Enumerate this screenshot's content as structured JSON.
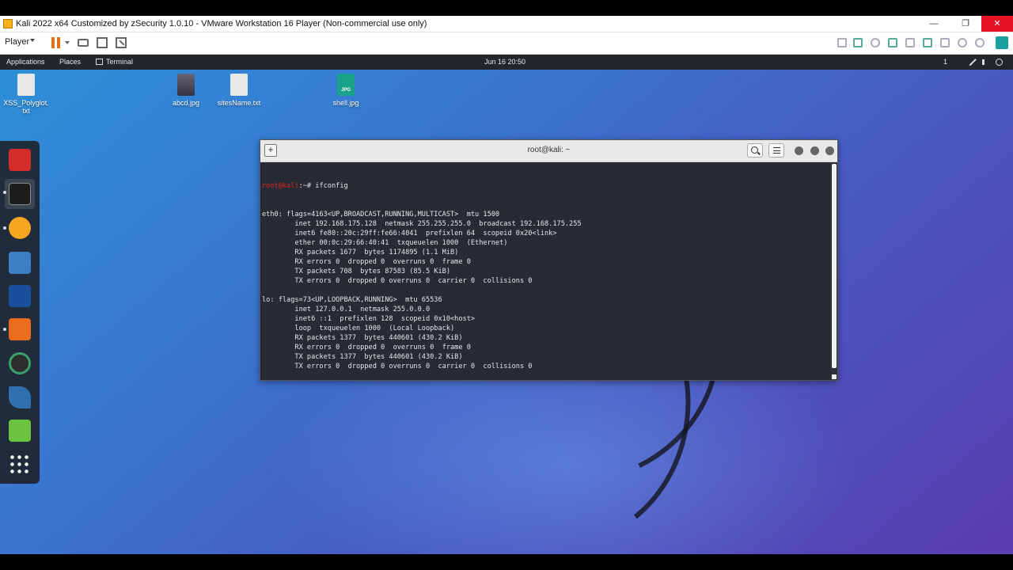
{
  "vm_window": {
    "title": "Kali 2022 x64 Customized by zSecurity 1.0.10 - VMware Workstation 16 Player (Non-commercial use only)",
    "minimize": "—",
    "maximize": "❐",
    "close": "✕"
  },
  "vm_toolbar": {
    "player_menu": "Player"
  },
  "kali_panel": {
    "applications": "Applications",
    "places": "Places",
    "terminal": "Terminal",
    "clock": "Jun 16  20:50",
    "workspace": "1"
  },
  "desktop_icons": [
    {
      "label": "XSS_Polyglot.\ntxt",
      "icon": "text-file-icon"
    },
    {
      "label": "abcd.jpg",
      "icon": "image-file-icon"
    },
    {
      "label": "sitesName.txt",
      "icon": "text-file-icon"
    },
    {
      "label": "shell.jpg",
      "icon": "jpg-file-icon",
      "badge": "JPG"
    }
  ],
  "dock": {
    "items": [
      "terminal-red-icon",
      "terminal-icon",
      "firefox-icon",
      "files-icon",
      "metasploit-icon",
      "burpsuite-icon",
      "maltego-icon",
      "kali-dragon-icon",
      "text-editor-icon",
      "app-grid-icon"
    ]
  },
  "terminal": {
    "title": "root@kali: ~",
    "newtab": "+",
    "prompt_user": "root@kali",
    "prompt_sep": ":~# ",
    "command": "ifconfig",
    "output": [
      "eth0: flags=4163<UP,BROADCAST,RUNNING,MULTICAST>  mtu 1500",
      "        inet 192.168.175.128  netmask 255.255.255.0  broadcast 192.168.175.255",
      "        inet6 fe80::20c:29ff:fe66:4041  prefixlen 64  scopeid 0x20<link>",
      "        ether 00:0c:29:66:40:41  txqueuelen 1000  (Ethernet)",
      "        RX packets 1677  bytes 1174895 (1.1 MiB)",
      "        RX errors 0  dropped 0  overruns 0  frame 0",
      "        TX packets 708  bytes 87583 (85.5 KiB)",
      "        TX errors 0  dropped 0 overruns 0  carrier 0  collisions 0",
      "",
      "lo: flags=73<UP,LOOPBACK,RUNNING>  mtu 65536",
      "        inet 127.0.0.1  netmask 255.0.0.0",
      "        inet6 ::1  prefixlen 128  scopeid 0x10<host>",
      "        loop  txqueuelen 1000  (Local Loopback)",
      "        RX packets 1377  bytes 440601 (430.2 KiB)",
      "        RX errors 0  dropped 0  overruns 0  frame 0",
      "        TX packets 1377  bytes 440601 (430.2 KiB)",
      "        TX errors 0  dropped 0 overruns 0  carrier 0  collisions 0",
      ""
    ]
  }
}
